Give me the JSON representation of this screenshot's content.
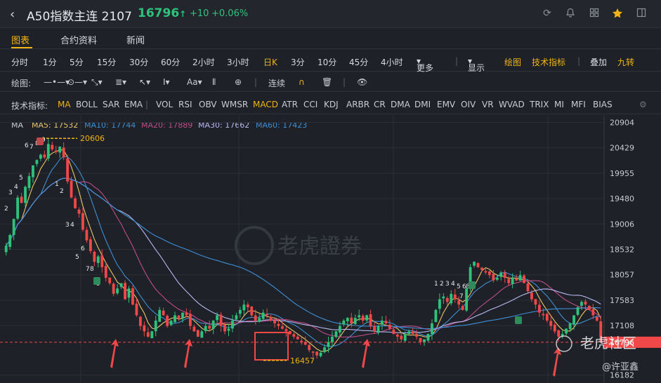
{
  "header": {
    "back_icon": "chevron-left-icon",
    "name": "A50指数主连 2107",
    "price": "16796",
    "arrow": "↑",
    "change": "+10",
    "change_pct": "+0.06%",
    "icons": [
      "refresh-icon",
      "bell-icon",
      "grid-icon",
      "star-icon",
      "panel-icon"
    ],
    "colors": {
      "up": "#2ec37a",
      "down": "#f04848",
      "accent": "#f0b514"
    }
  },
  "tabs": [
    "图表",
    "合约资料",
    "新闻"
  ],
  "periods": {
    "items": [
      "分时",
      "1分",
      "5分",
      "15分",
      "30分",
      "60分",
      "2小时",
      "3小时",
      "日K",
      "3分",
      "10分",
      "45分",
      "4小时"
    ],
    "active": "日K",
    "more": "更多",
    "display": "显示",
    "draw": "绘图",
    "tech": "技术指标",
    "overlay": "叠加",
    "nine": "九转"
  },
  "drawtools": {
    "label": "绘图:",
    "continuous": "连续"
  },
  "indicators": {
    "label": "技术指标:",
    "items": [
      "MA",
      "BOLL",
      "SAR",
      "EMA",
      "VOL",
      "RSI",
      "OBV",
      "WMSR",
      "MACD",
      "ATR",
      "CCI",
      "KDJ",
      "ARBR",
      "CR",
      "DMA",
      "DMI",
      "EMV",
      "OIV",
      "VR",
      "WVAD",
      "TRIX",
      "MI",
      "MFI",
      "BIAS"
    ],
    "active": [
      "MA",
      "MACD"
    ]
  },
  "ma_legend": {
    "title": "MA",
    "ma5": "MA5: 17532",
    "ma10": "MA10: 17744",
    "ma20": "MA20: 17889",
    "ma30": "MA30: 17662",
    "ma60": "MA60: 17423",
    "colors": {
      "ma5": "#e8c66a",
      "ma10": "#3f8fd0",
      "ma20": "#c04b8a",
      "ma30": "#b8b8f0",
      "ma60": "#3d8fd8"
    }
  },
  "chart_data": {
    "type": "candlestick",
    "y_axis_labels": [
      "20904",
      "20429",
      "19955",
      "19480",
      "19006",
      "18532",
      "18057",
      "17583",
      "17108",
      "16796",
      "16182"
    ],
    "ylim": [
      16100,
      20950
    ],
    "high_label": "20606",
    "low_label": "16457",
    "current_price": "16796",
    "watermark": "老虎證券",
    "bottom_watermark": "老虎社区",
    "author": "@许亚鑫",
    "td_labels_up": [
      "2",
      "3",
      "4",
      "5",
      "6",
      "7",
      "8",
      "9"
    ],
    "td_labels_down": [
      "1",
      "2",
      "3",
      "4",
      "5",
      "6",
      "7",
      "8",
      "9"
    ],
    "td_mid": [
      "1",
      "2",
      "3",
      "4",
      "5",
      "6",
      "7",
      "8",
      "9"
    ],
    "closes": [
      18600,
      18800,
      19100,
      19500,
      19400,
      19700,
      19900,
      20100,
      20200,
      20300,
      20250,
      20500,
      20400,
      20350,
      20450,
      20250,
      19800,
      19500,
      19300,
      19200,
      18900,
      18700,
      18500,
      18300,
      18400,
      18200,
      18000,
      17900,
      17700,
      17800,
      17900,
      17600,
      17800,
      17500,
      17300,
      17100,
      17000,
      16900,
      17000,
      17200,
      17400,
      17300,
      17100,
      17200,
      17300,
      17250,
      17350,
      17300,
      17100,
      17000,
      16900,
      17000,
      17100,
      17050,
      17200,
      17300,
      17100,
      17000,
      17050,
      17200,
      17300,
      17400,
      17500,
      17450,
      17300,
      17200,
      17250,
      17350,
      17300,
      17200,
      17150,
      17100,
      17050,
      17000,
      16950,
      16900,
      16850,
      16800,
      16750,
      16650,
      16600,
      16550,
      16600,
      16700,
      16800,
      16900,
      17000,
      17100,
      17200,
      17250,
      17150,
      17250,
      17300,
      17200,
      17300,
      17100,
      17000,
      17100,
      17200,
      17150,
      17050,
      16950,
      16900,
      16850,
      16950,
      17000,
      16950,
      16900,
      16800,
      16850,
      16950,
      17150,
      17400,
      17600,
      17650,
      17550,
      17700,
      17600,
      17500,
      17400,
      17800,
      18200,
      18300,
      18200,
      18150,
      18100,
      18050,
      17950,
      18000,
      18100,
      18000,
      17900,
      18000,
      17950,
      18050,
      17900,
      17750,
      17600,
      17500,
      17350,
      17300,
      17200,
      17100,
      17000,
      16900,
      16950,
      17050,
      17150,
      17300,
      17450,
      17550,
      17500,
      17400,
      17300,
      17200,
      16796
    ]
  }
}
